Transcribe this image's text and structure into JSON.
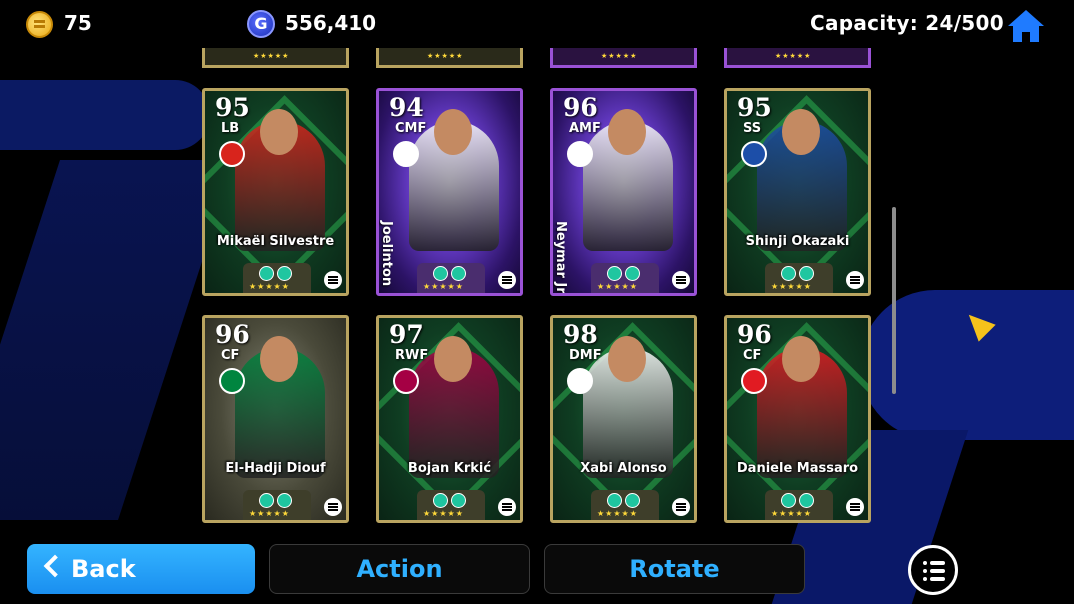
{
  "topbar": {
    "coins": "75",
    "coin_icon": "coin-icon",
    "gp": "556,410",
    "gp_icon": "gp-icon",
    "gp_symbol": "G",
    "capacity": "Capacity: 24/500",
    "home_icon": "home-icon"
  },
  "cards": [
    {
      "rating": "95",
      "position": "LB",
      "name": "Mikaël Silvestre",
      "frame": "gold",
      "art": "green",
      "club_color": "#d8241c"
    },
    {
      "rating": "94",
      "position": "CMF",
      "name": "Joelinton",
      "frame": "purple",
      "art": "violet",
      "club_color": "#ffffff"
    },
    {
      "rating": "96",
      "position": "AMF",
      "name": "Neymar Jr",
      "frame": "purple",
      "art": "violet",
      "club_color": "#ffffff"
    },
    {
      "rating": "95",
      "position": "SS",
      "name": "Shinji Okazaki",
      "frame": "gold",
      "art": "green",
      "club_color": "#1c4ea8"
    },
    {
      "rating": "96",
      "position": "CF",
      "name": "El-Hadji Diouf",
      "frame": "gold",
      "art": "legend",
      "club_color": "#00853f"
    },
    {
      "rating": "97",
      "position": "RWF",
      "name": "Bojan Krkić",
      "frame": "gold",
      "art": "green",
      "club_color": "#a50044"
    },
    {
      "rating": "98",
      "position": "DMF",
      "name": "Xabi Alonso",
      "frame": "gold",
      "art": "green",
      "club_color": "#ffffff"
    },
    {
      "rating": "96",
      "position": "CF",
      "name": "Daniele Massaro",
      "frame": "gold",
      "art": "green",
      "club_color": "#e11b22"
    }
  ],
  "stars": "★★★★★",
  "buttons": {
    "back": "Back",
    "action": "Action",
    "rotate": "Rotate",
    "menu_icon": "list-menu-icon"
  }
}
